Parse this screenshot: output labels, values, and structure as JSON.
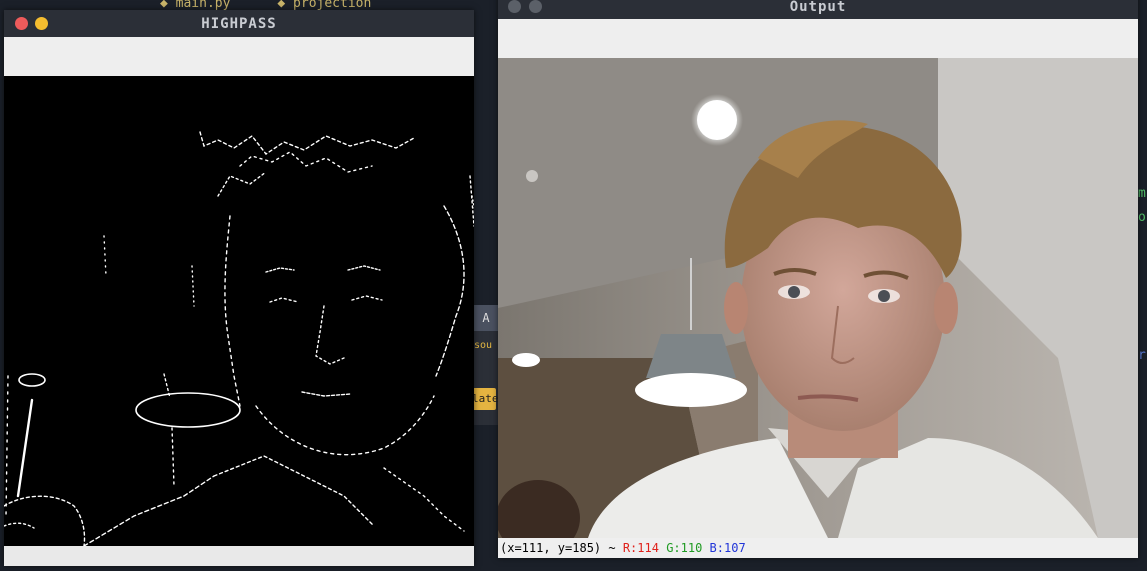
{
  "highpass_window": {
    "title": "HIGHPASS"
  },
  "output_window": {
    "title": "Output",
    "status": {
      "coords": "(x=111, y=185) ~ ",
      "r": "R:114",
      "g": "G:110",
      "b": "B:107"
    }
  },
  "background": {
    "dialog_header": "A",
    "dialog_label": "sou",
    "dialog_button": "late"
  },
  "colors": {
    "titlebar": "#2b2f37",
    "close": "#ee5b5b",
    "minimize": "#f5bd2f",
    "inactive_dot": "#5b6068",
    "desktop": "#1b2029"
  }
}
